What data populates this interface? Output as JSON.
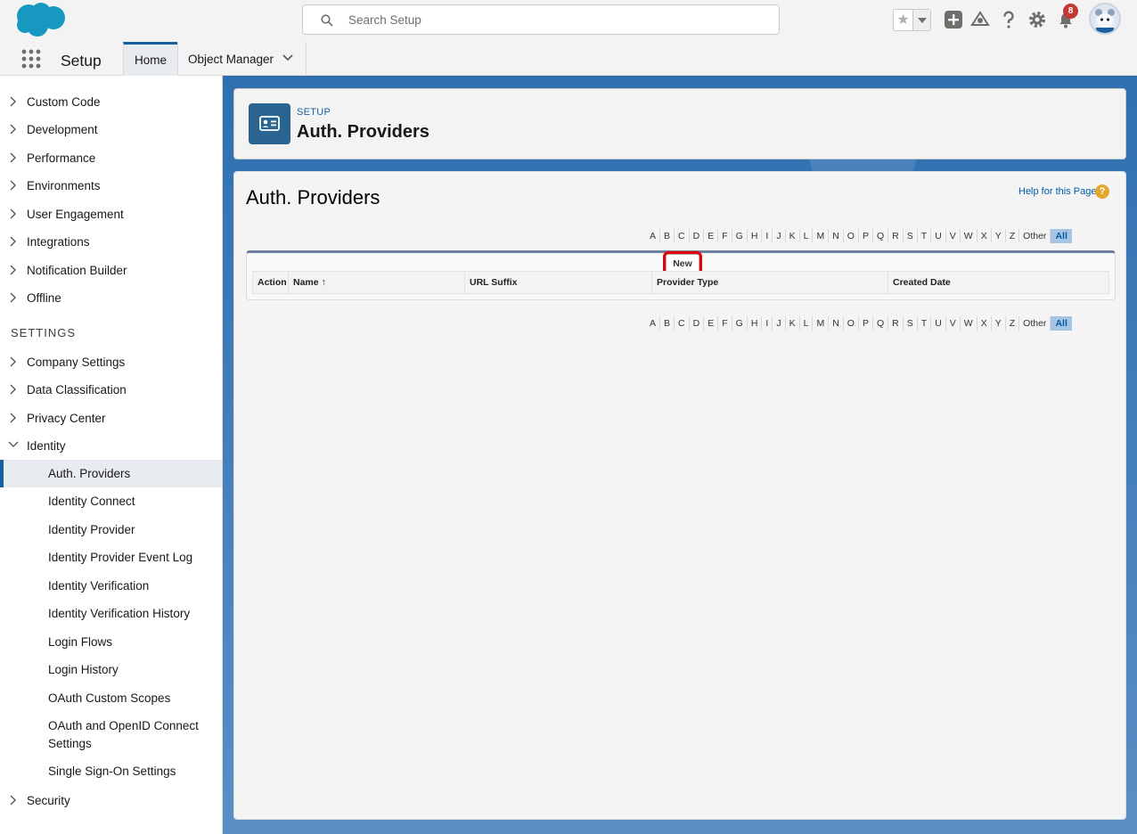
{
  "header": {
    "search_placeholder": "Search Setup",
    "notification_count": "8",
    "icons": [
      "salesforce-cloud-logo",
      "search-icon",
      "star-icon",
      "add-icon",
      "trailhead-icon",
      "help-icon",
      "gear-icon",
      "bell-icon",
      "avatar"
    ]
  },
  "context_bar": {
    "app_name": "Setup",
    "tabs": [
      {
        "label": "Home",
        "active": true
      },
      {
        "label": "Object Manager",
        "active": false
      }
    ]
  },
  "sidebar": {
    "items_top": [
      {
        "label": "Custom Code"
      },
      {
        "label": "Development"
      },
      {
        "label": "Performance"
      },
      {
        "label": "Environments"
      },
      {
        "label": "User Engagement"
      },
      {
        "label": "Integrations"
      },
      {
        "label": "Notification Builder"
      },
      {
        "label": "Offline"
      }
    ],
    "section_settings": "SETTINGS",
    "items_settings": [
      {
        "label": "Company Settings",
        "expanded": false
      },
      {
        "label": "Data Classification",
        "expanded": false
      },
      {
        "label": "Privacy Center",
        "expanded": false
      },
      {
        "label": "Identity",
        "expanded": true
      }
    ],
    "identity_children": [
      {
        "label": "Auth. Providers",
        "active": true
      },
      {
        "label": "Identity Connect"
      },
      {
        "label": "Identity Provider"
      },
      {
        "label": "Identity Provider Event Log"
      },
      {
        "label": "Identity Verification"
      },
      {
        "label": "Identity Verification History"
      },
      {
        "label": "Login Flows"
      },
      {
        "label": "Login History"
      },
      {
        "label": "OAuth Custom Scopes"
      },
      {
        "label": "OAuth and OpenID Connect Settings"
      },
      {
        "label": "Single Sign-On Settings"
      }
    ],
    "items_bottom": [
      {
        "label": "Security"
      }
    ]
  },
  "page_header": {
    "eyebrow": "SETUP",
    "title": "Auth. Providers"
  },
  "main": {
    "title": "Auth. Providers",
    "help_link": "Help for this Page",
    "help_icon_glyph": "?",
    "alpha_filter": [
      "A",
      "B",
      "C",
      "D",
      "E",
      "F",
      "G",
      "H",
      "I",
      "J",
      "K",
      "L",
      "M",
      "N",
      "O",
      "P",
      "Q",
      "R",
      "S",
      "T",
      "U",
      "V",
      "W",
      "X",
      "Y",
      "Z",
      "Other",
      "All"
    ],
    "alpha_selected": "All",
    "new_button": "New",
    "columns": [
      {
        "label": "Action"
      },
      {
        "label": "Name ↑"
      },
      {
        "label": "URL Suffix"
      },
      {
        "label": "Provider Type"
      },
      {
        "label": "Created Date"
      }
    ]
  },
  "colors": {
    "brand_blue": "#1b5f9e",
    "highlight_red": "#e3010c",
    "badge_red": "#c23934"
  }
}
